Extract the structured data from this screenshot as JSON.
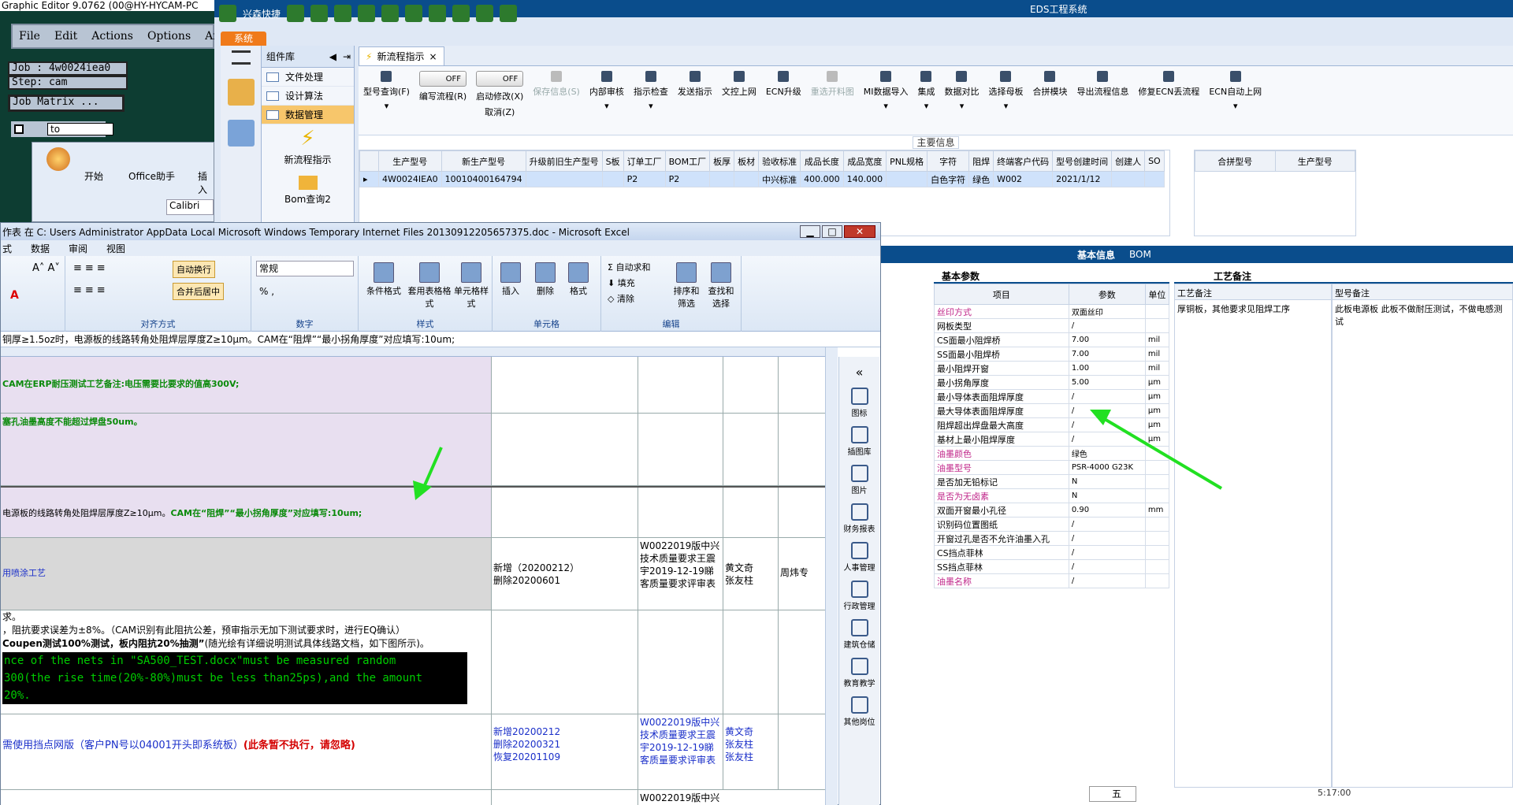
{
  "ge": {
    "title": "Graphic Editor 9.0762 (00@HY-HYCAM-PC",
    "menu": [
      "File",
      "Edit",
      "Actions",
      "Options",
      "Analy"
    ],
    "job": "Job : 4w0024iea0",
    "step": "Step: cam",
    "matrix": "Job Matrix ...",
    "to": "to"
  },
  "office_win": {
    "tab_start": "开始",
    "tab_assistant": "Office助手",
    "tab_insert": "插入",
    "font": "Calibri"
  },
  "eds": {
    "title": "EDS工程系统",
    "app_label": "兴森快捷",
    "system_tab": "系统",
    "lib": {
      "header": "组件库",
      "items": [
        "文件处理",
        "设计算法",
        "数据管理"
      ],
      "big": [
        "新流程指示",
        "Bom查询2"
      ]
    },
    "doc_tab": "新流程指示",
    "ribbon": [
      "型号查询(F)",
      "编写流程(R)",
      "启动修改(X)",
      "保存信息(S)",
      "内部审核",
      "指示检查",
      "发送指示",
      "文控上网",
      "ECN升级",
      "重选开料图",
      "MI数据导入",
      "集成",
      "数据对比",
      "选择母板",
      "合拼模块",
      "导出流程信息",
      "修复ECN丢流程",
      "ECN自动上网"
    ],
    "off": "OFF",
    "cancel": "取消(Z)",
    "section_main": "主要信息",
    "grid_headers": [
      "生产型号",
      "新生产型号",
      "升级前旧生产型号",
      "S板",
      "订单工厂",
      "BOM工厂",
      "板厚",
      "板材",
      "验收标准",
      "成品长度",
      "成品宽度",
      "PNL规格",
      "字符",
      "阻焊",
      "终端客户代码",
      "型号创建时间",
      "创建人",
      "SO"
    ],
    "grid_row": [
      "4W0024IEA0",
      "10010400164794",
      "",
      "",
      "P2",
      "P2",
      "",
      "",
      "中兴标准",
      "400.000",
      "140.000",
      "",
      "白色字符",
      "绿色",
      "W002",
      "2021/1/12",
      "",
      ""
    ],
    "right_headers": [
      "合拼型号",
      "生产型号"
    ],
    "tabs": [
      "基本信息",
      "BOM"
    ],
    "basic_params": "基本参数",
    "craft_note": "工艺备注",
    "param_headers": [
      "项目",
      "参数",
      "单位"
    ],
    "params": [
      {
        "k": "丝印方式",
        "v": "双面丝印",
        "u": "",
        "pink": true
      },
      {
        "k": "网板类型",
        "v": "/",
        "u": "",
        "pink": false
      },
      {
        "k": "CS面最小阻焊桥",
        "v": "7.00",
        "u": "mil",
        "pink": false
      },
      {
        "k": "SS面最小阻焊桥",
        "v": "7.00",
        "u": "mil",
        "pink": false
      },
      {
        "k": "最小阻焊开窗",
        "v": "1.00",
        "u": "mil",
        "pink": false
      },
      {
        "k": "最小拐角厚度",
        "v": "5.00",
        "u": "μm",
        "pink": false
      },
      {
        "k": "最小导体表面阻焊厚度",
        "v": "/",
        "u": "μm",
        "pink": false
      },
      {
        "k": "最大导体表面阻焊厚度",
        "v": "/",
        "u": "μm",
        "pink": false
      },
      {
        "k": "阻焊超出焊盘最大高度",
        "v": "/",
        "u": "μm",
        "pink": false
      },
      {
        "k": "基材上最小阻焊厚度",
        "v": "/",
        "u": "μm",
        "pink": false
      },
      {
        "k": "油墨颜色",
        "v": "绿色",
        "u": "",
        "pink": true
      },
      {
        "k": "油墨型号",
        "v": "PSR-4000 G23K",
        "u": "",
        "pink": true
      },
      {
        "k": "是否加无铅标记",
        "v": "N",
        "u": "",
        "pink": false
      },
      {
        "k": "是否为无卤素",
        "v": "N",
        "u": "",
        "pink": true
      },
      {
        "k": "双面开窗最小孔径",
        "v": "0.90",
        "u": "mm",
        "pink": false
      },
      {
        "k": "识别码位置图纸",
        "v": "/",
        "u": "",
        "pink": false
      },
      {
        "k": "开窗过孔是否不允许油墨入孔",
        "v": "/",
        "u": "",
        "pink": false
      },
      {
        "k": "CS挡点菲林",
        "v": "/",
        "u": "",
        "pink": false
      },
      {
        "k": "SS挡点菲林",
        "v": "/",
        "u": "",
        "pink": false
      },
      {
        "k": "油墨名称",
        "v": "/",
        "u": "",
        "pink": true
      }
    ],
    "craft_headers": [
      "工艺备注",
      "型号备注"
    ],
    "craft_text": "厚铜板，其他要求见阻焊工序",
    "model_text": "此板电源板     此板不做耐压测试，不做电感测试",
    "clock": "5:17:00",
    "ime": "五"
  },
  "excel": {
    "title": "作表 在 C: Users Administrator AppData Local Microsoft Windows Temporary Internet Files 20130912205657375.doc - Microsoft Excel",
    "menu": [
      "式",
      "数据",
      "审阅",
      "视图"
    ],
    "groups": [
      "对齐方式",
      "数字",
      "样式",
      "单元格",
      "编辑"
    ],
    "btn_wrap": "自动换行",
    "btn_merge": "合并后居中",
    "num_format": "常规",
    "btn_cond": "条件格式",
    "btn_table": "套用表格格式",
    "btn_cellstyle": "单元格样式",
    "btn_insert": "插入",
    "btn_delete": "删除",
    "btn_format": "格式",
    "btn_autosum": "自动求和",
    "btn_fill": "填充",
    "btn_clear": "清除",
    "btn_sort": "排序和筛选",
    "btn_find": "查找和选择",
    "formula": "铜厚≥1.5oz时，电源板的线路转角处阻焊层厚度Z≥10μm。CAM在“阻焊”“最小拐角厚度”对应填写:10um;",
    "rows": {
      "r1": "CAM在ERP耐压测试工艺备注:电压需要比要求的值高300V;",
      "r2": "塞孔油墨高度不能超过焊盘50um。",
      "r3a": "电源板的线路转角处阻焊层厚度Z≥10μm。",
      "r3b": "CAM在“阻焊”“最小拐角厚度”对应填写:10um;",
      "r4": "用喷涂工艺",
      "r4p": "新增（20200212）\n删除20200601",
      "r4q": "W0022019版中兴技术质量要求王震宇2019-12-19睇客质量要求评审表",
      "r4r": "黄文奇\n张友柱",
      "r4s": "周炜专",
      "r5a": "求。",
      "r5b": "，阻抗要求误差为±8%。（CAM识别有此阻抗公差，预审指示无加下测试要求时，进行EQ确认）",
      "r5c1": "Coupen测试100%测试，板内阻抗20%抽测”",
      "r5c2": "(随光绘有详细说明测试具体线路文档，如下图所示)。",
      "r5d": "nce of the nets in \"SA500_TEST.docx\"must be measured random",
      "r5e": "300(the rise time(20%-80%)must be less than25ps),and the amount",
      "r5f": "20%.",
      "r6a": "需使用挡点网版（客户PN号以04001开头即系统板）",
      "r6b": "(此条暂不执行，请忽略)",
      "r6p": "新增20200212\n删除20200321\n恢复20201109",
      "r6q": "W0022019版中兴技术质量要求王震宇2019-12-19睇客质量要求评审表",
      "r6r": "黄文奇\n张友柱\n张友柱",
      "r7q": "W0022019版中兴"
    },
    "side": [
      "图标",
      "插图库",
      "图片",
      "财务报表",
      "人事管理",
      "行政管理",
      "建筑仓储",
      "教育教学",
      "其他岗位"
    ]
  }
}
